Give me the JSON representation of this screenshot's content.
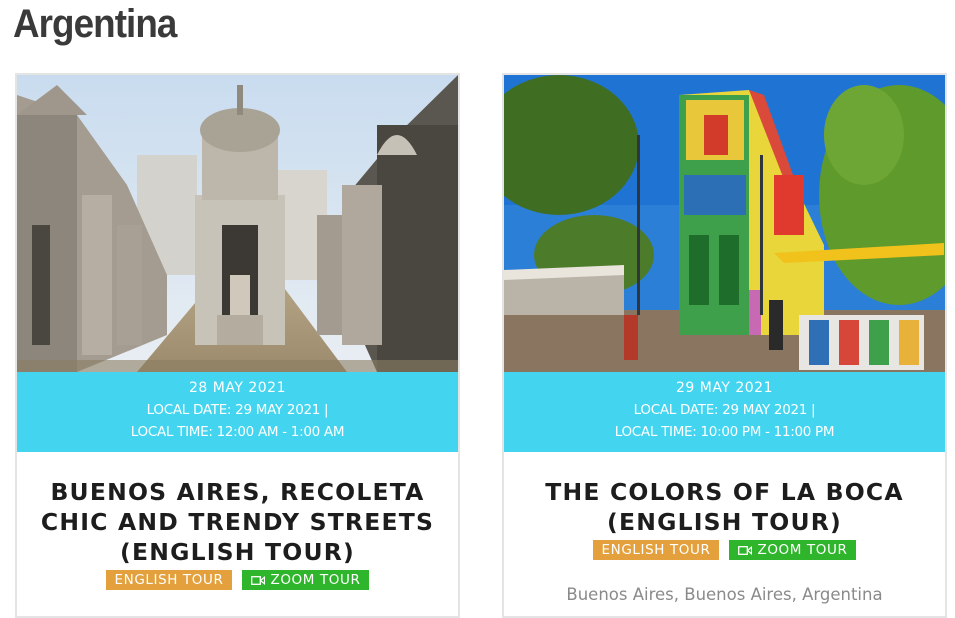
{
  "page": {
    "title": "Argentina"
  },
  "cards": [
    {
      "date": "28 MAY 2021",
      "local_date": "LOCAL DATE: 29 MAY 2021  |",
      "local_time": "LOCAL TIME: 12:00 AM - 1:00 AM",
      "title": "BUENOS AIRES, RECOLETA CHIC AND TRENDY STREETS (ENGLISH TOUR)",
      "badges": {
        "language": "ENGLISH TOUR",
        "zoom": "ZOOM TOUR"
      },
      "photo_icon": "recoleta-cemetery-photo"
    },
    {
      "date": "29 MAY 2021",
      "local_date": "LOCAL DATE: 29 MAY 2021  |",
      "local_time": "LOCAL TIME: 10:00 PM - 11:00 PM",
      "title": "THE COLORS OF LA BOCA (ENGLISH TOUR)",
      "badges": {
        "language": "ENGLISH TOUR",
        "zoom": "ZOOM TOUR"
      },
      "location": "Buenos Aires, Buenos Aires, Argentina",
      "photo_icon": "la-boca-photo"
    }
  ],
  "colors": {
    "accent_band": "#43d5ef",
    "language_badge": "#e3a03c",
    "zoom_badge": "#2fb52b"
  }
}
